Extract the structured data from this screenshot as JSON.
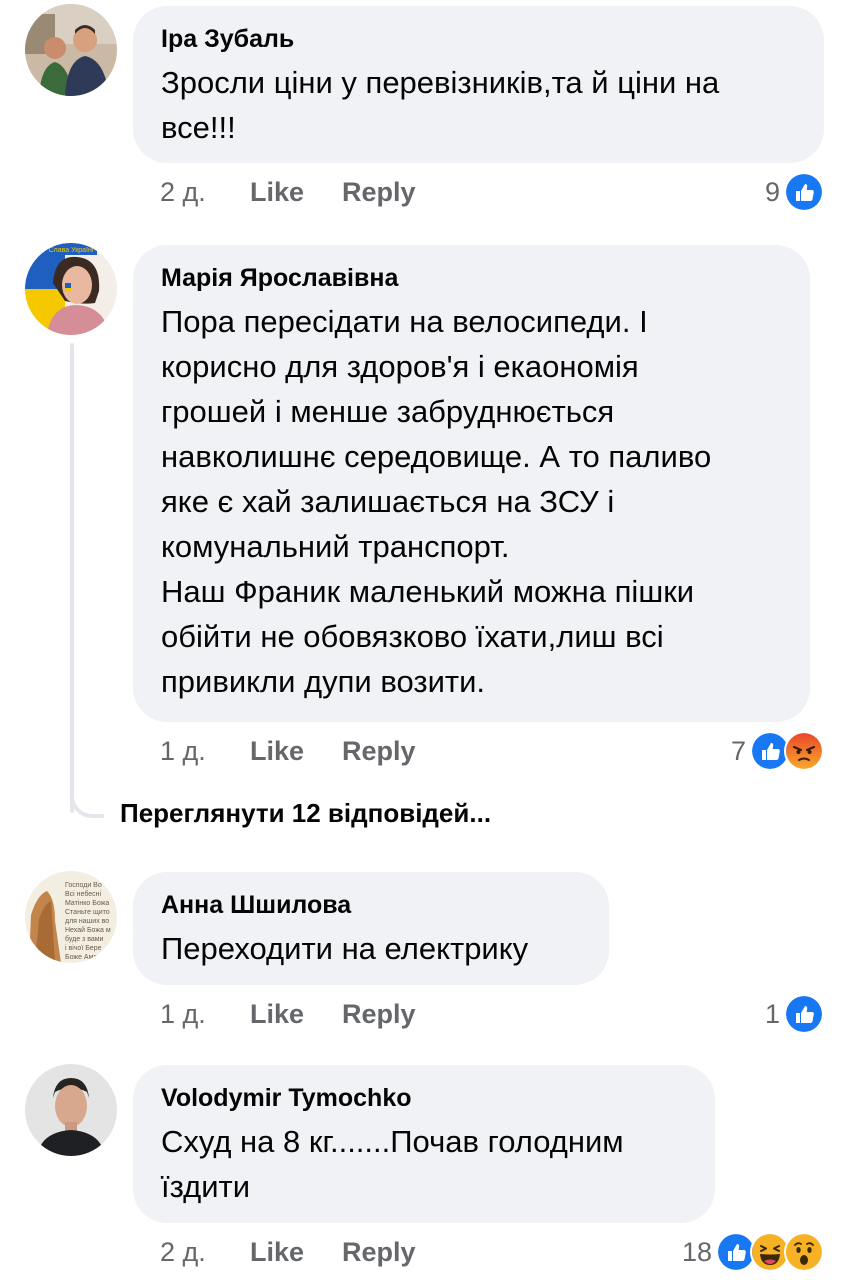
{
  "comments": [
    {
      "author": "Іра Зубаль",
      "lines": [
        "Зросли ціни у перевізників,та й ціни на",
        "все!!!"
      ],
      "time": "2 д.",
      "like": "Like",
      "reply": "Reply",
      "reaction_count": "9",
      "reactions": [
        "like-icon"
      ]
    },
    {
      "author": "Марія Ярославівна",
      "lines": [
        "Пора пересідати на велосипеди. І",
        "корисно для здоров'я і екаономія",
        "грошей і менше забруднюється",
        "навколишнє середовище. А то паливо",
        "яке є хай залишається на ЗСУ і",
        "комунальний транспорт.",
        "Наш Франик маленький можна пішки",
        "обійти не обовязково їхати,лиш всі",
        "привикли дупи возити."
      ],
      "time": "1 д.",
      "like": "Like",
      "reply": "Reply",
      "reaction_count": "7",
      "reactions": [
        "like-icon",
        "angry-icon"
      ]
    },
    {
      "author": "Анна Шшилова",
      "lines": [
        "Переходити на електрику"
      ],
      "time": "1 д.",
      "like": "Like",
      "reply": "Reply",
      "reaction_count": "1",
      "reactions": [
        "like-icon"
      ]
    },
    {
      "author": "Volodymir Tymochko",
      "lines": [
        "Схуд на 8 кг.......Почав голодним",
        "їздити"
      ],
      "time": "2 д.",
      "like": "Like",
      "reply": "Reply",
      "reaction_count": "18",
      "reactions": [
        "like-icon",
        "haha-icon",
        "wow-icon"
      ]
    }
  ],
  "view_replies": "Переглянути 12 відповідей...",
  "colors": {
    "bubble": "#f0f2f5",
    "meta_text": "#65676b",
    "like_blue": "#1877f2",
    "angry_orange": "#f0562a",
    "haha_yellow": "#f7b125"
  },
  "avatar_texts": {
    "avatar_2_banner": "Слава Україні",
    "avatar_3_prayer": [
      "Господи Во",
      "Всі небесні",
      "Матінко Божа",
      "Станьте щито",
      "для наших во",
      "Нехай Божа м",
      "буде з вами",
      "і вічої Бере",
      "Боже Амен"
    ]
  }
}
